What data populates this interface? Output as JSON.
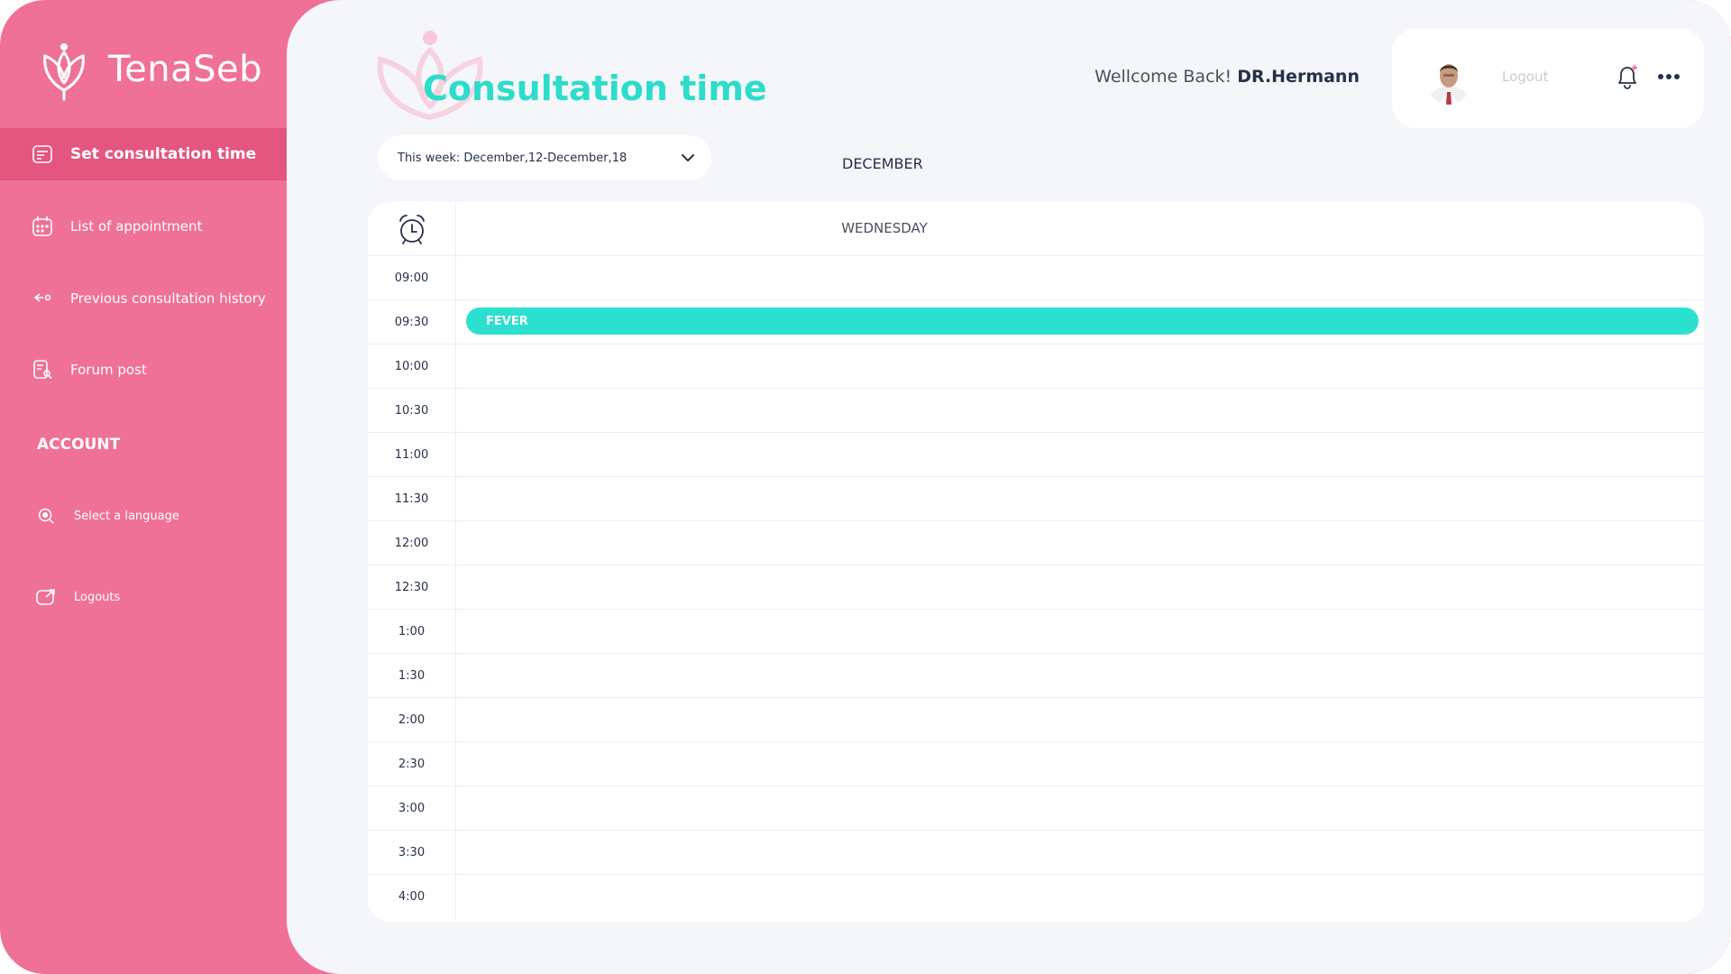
{
  "brand": {
    "name": "TenaSeb"
  },
  "sidebar": {
    "items": [
      {
        "label": "Set consultation time",
        "icon": "schedule-icon",
        "active": true
      },
      {
        "label": "List of appointment",
        "icon": "calendar-icon"
      },
      {
        "label": "Previous consultation history",
        "icon": "history-icon"
      },
      {
        "label": "Forum post",
        "icon": "forum-icon"
      }
    ],
    "account_label": "ACCOUNT",
    "account_items": [
      {
        "label": "Select a language",
        "icon": "language-icon"
      },
      {
        "label": "Logouts",
        "icon": "logout-icon"
      }
    ]
  },
  "header": {
    "title": "Consultation time",
    "welcome_prefix": "Wellcome Back!",
    "doctor_name": "DR.Hermann",
    "logout_label": "Logout"
  },
  "filter": {
    "week_label": "This week: December,12-December,18",
    "month_label": "DECEMBER"
  },
  "calendar": {
    "day": "WEDNESDAY",
    "times": [
      "09:00",
      "09:30",
      "10:00",
      "10:30",
      "11:00",
      "11:30",
      "12:00",
      "12:30",
      "1:00",
      "1:30",
      "2:00",
      "2:30",
      "3:00",
      "3:30",
      "4:00"
    ],
    "events": [
      {
        "time": "09:30",
        "label": "FEVER"
      }
    ]
  },
  "colors": {
    "sidebar": "#ef7197",
    "active_item": "#e4557f",
    "accent": "#2ddccb",
    "event": "#2ce0d0",
    "background": "#f4f6f9"
  }
}
